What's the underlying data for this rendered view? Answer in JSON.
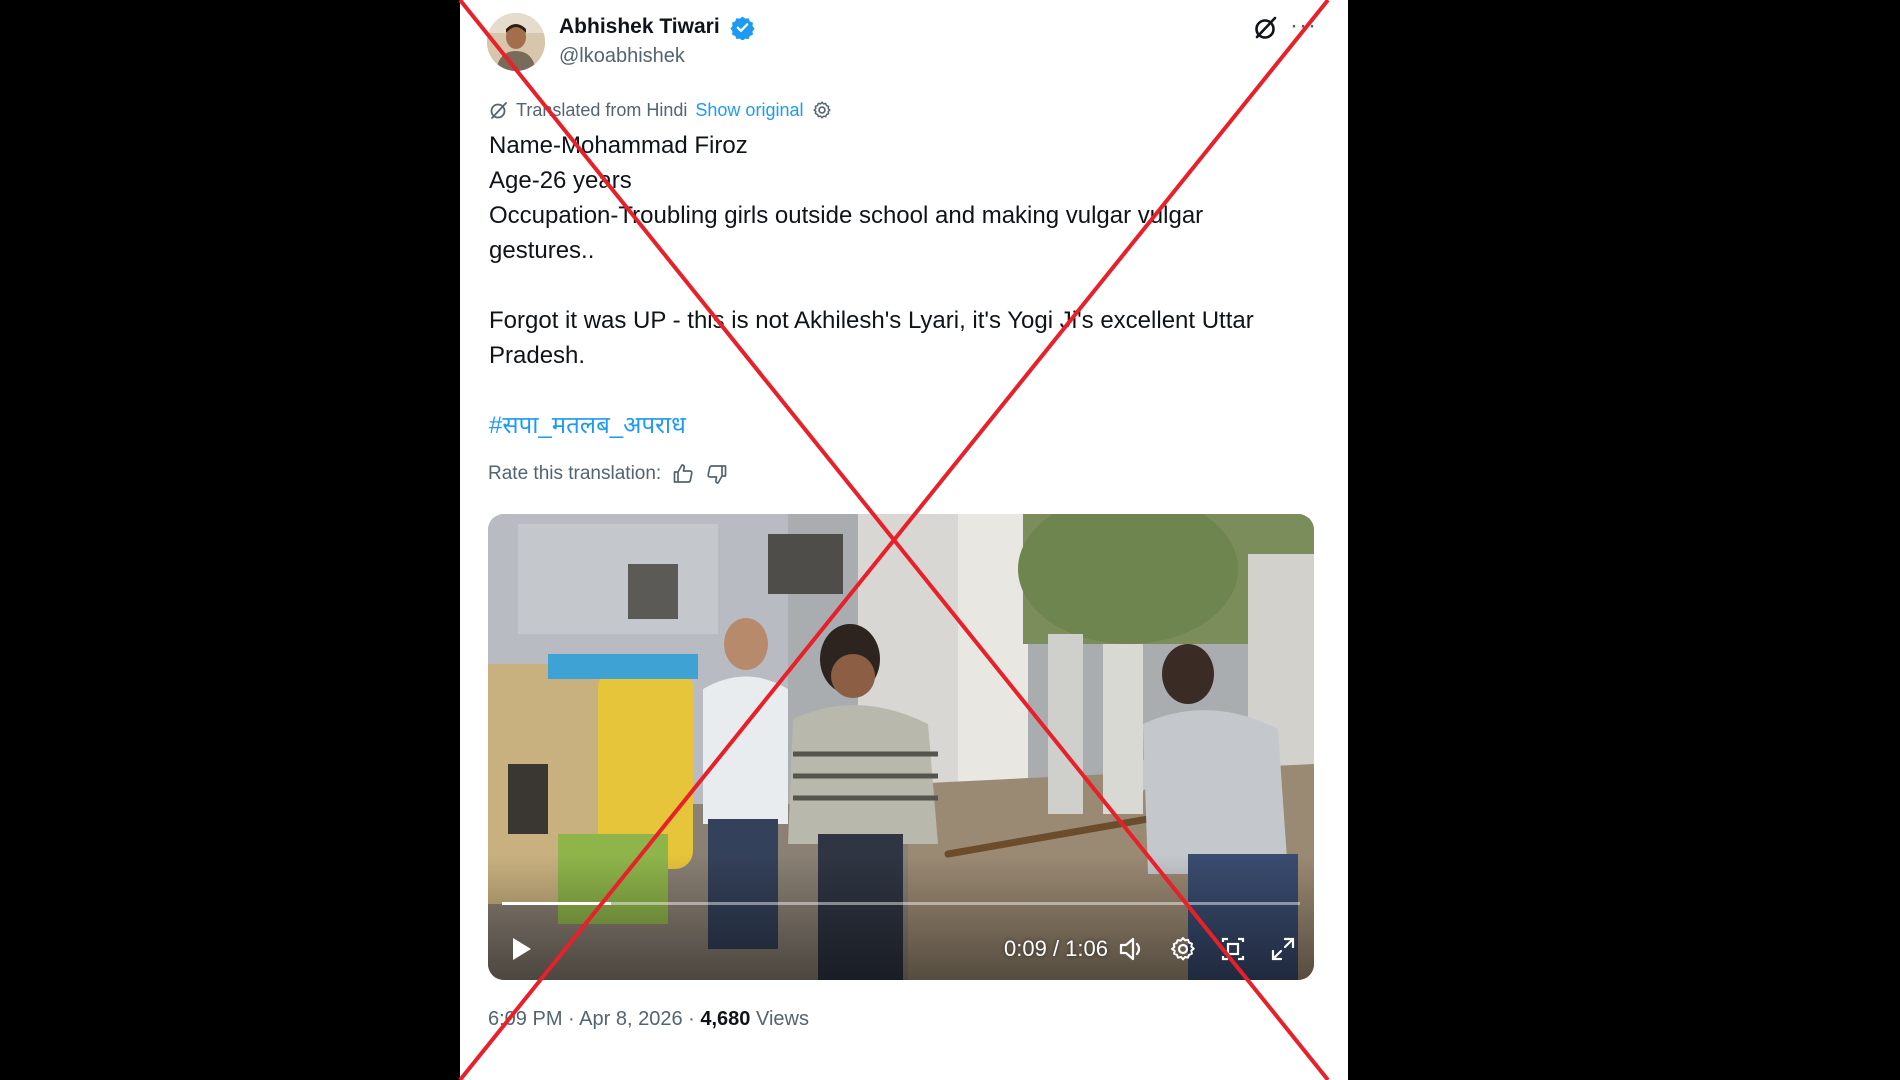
{
  "author": {
    "name": "Abhishek Tiwari",
    "handle": "@lkoabhishek",
    "verified": true
  },
  "translation": {
    "label": "Translated from Hindi",
    "show_original": "Show original"
  },
  "tweet": {
    "lines": [
      "Name-Mohammad Firoz",
      "Age-26 years",
      "Occupation-Troubling girls outside school and making vulgar vulgar",
      "gestures.."
    ],
    "paragraph2": [
      "Forgot it was UP - this is not Akhilesh's Lyari, it's Yogi Ji's excellent Uttar",
      "Pradesh."
    ],
    "hashtag": "#सपा_मतलब_अपराध"
  },
  "rate": {
    "label": "Rate this translation:"
  },
  "video": {
    "time": "0:09 / 1:06",
    "progress": 0.136
  },
  "meta": {
    "time": "6:09 PM",
    "date": "Apr 8, 2026",
    "views_count": "4,680",
    "views_label": "Views",
    "separator": " · "
  },
  "icons": {
    "verified": "verified-badge-icon",
    "grok": "grok-icon",
    "more": "more-icon",
    "translate": "translate-icon",
    "settings": "settings-icon",
    "thumbs_up": "thumbs-up-icon",
    "thumbs_down": "thumbs-down-icon",
    "play": "play-icon",
    "volume": "volume-icon",
    "video_settings": "gear-icon",
    "pip": "picture-in-picture-icon",
    "fullscreen": "fullscreen-icon"
  },
  "colors": {
    "accent": "#1d9bf0",
    "cross": "#e8202a",
    "text": "#0f1419",
    "muted": "#536471"
  }
}
